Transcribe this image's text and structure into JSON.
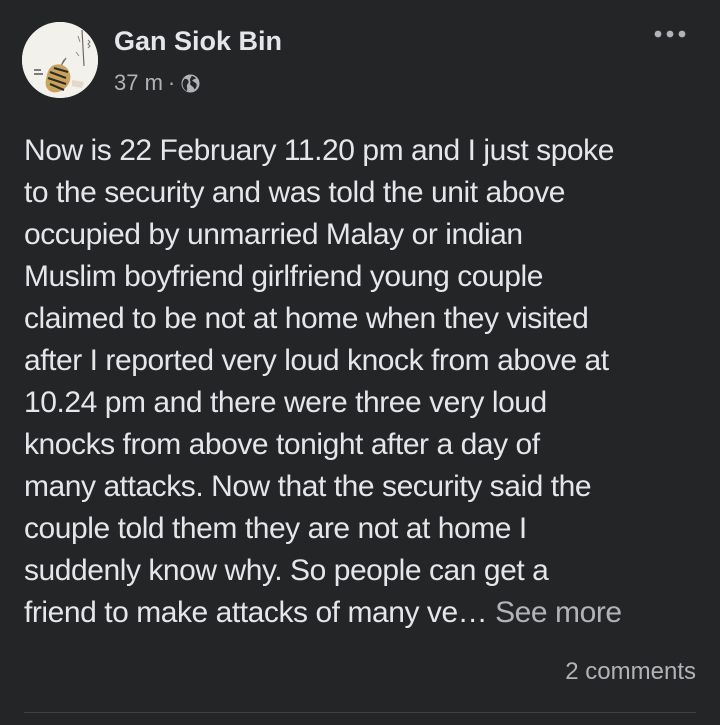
{
  "post": {
    "author": "Gan Siok Bin",
    "time": "37 m",
    "separator": "·",
    "privacy_icon": "globe-icon",
    "more_icon": "more-horizontal-icon",
    "avatar_icon": "profile-photo",
    "lines": [
      "Now is 22 February 11.20 pm and I just spoke",
      "to the security and was told the unit above",
      "occupied by unmarried Malay or indian",
      "Muslim boyfriend girlfriend young couple",
      "claimed to be not at home when they visited",
      "after I reported very loud knock from above at",
      "10.24 pm and there were three very loud",
      "knocks from above tonight after a day of",
      "many attacks.  Now that the security said the",
      "couple told them they are not at home I",
      "suddenly know why. So people can get a",
      "friend to make attacks of many ve… "
    ],
    "see_more": "See more",
    "comments": "2 comments"
  },
  "colors": {
    "background": "#242526",
    "primary_text": "#e4e6eb",
    "secondary_text": "#b0b3b8",
    "divider": "#3e4042"
  }
}
